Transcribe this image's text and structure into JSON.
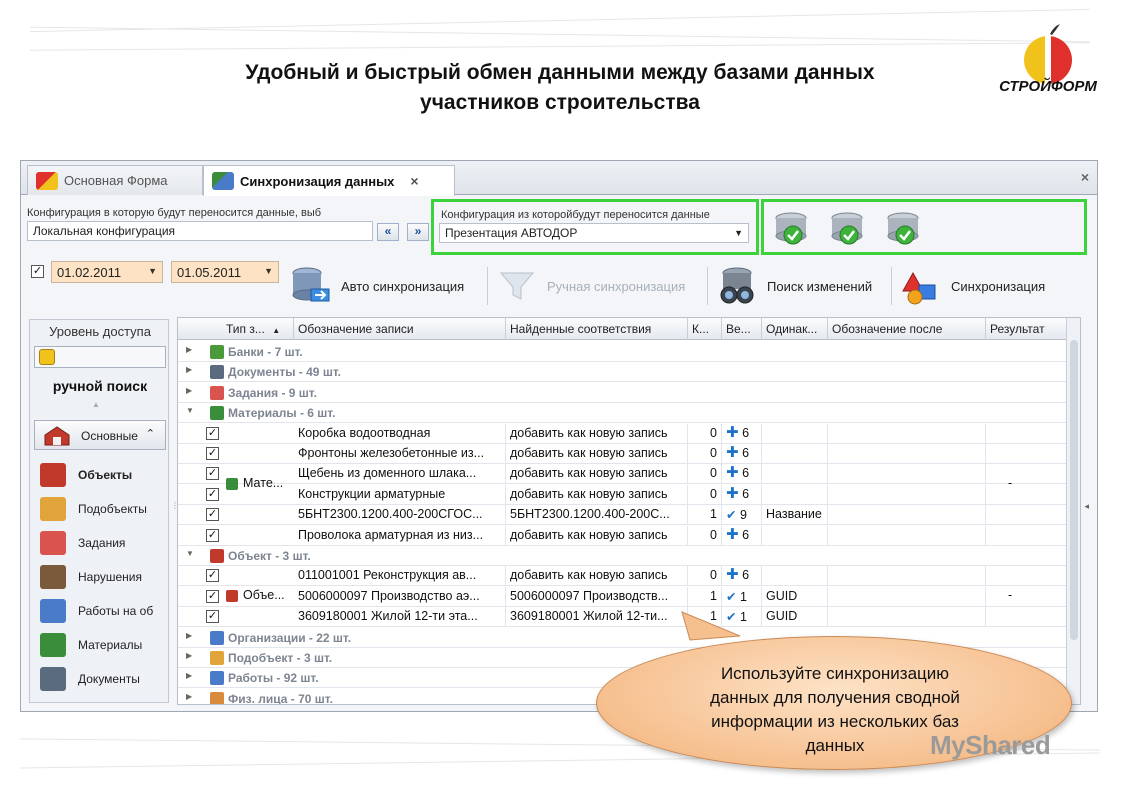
{
  "slide": {
    "title_line1": "Удобный и быстрый обмен данными между базами данных",
    "title_line2": "участников строительства",
    "logo_text": "СТРОЙФОРМ"
  },
  "window": {
    "tabs": [
      {
        "label": "Основная Форма",
        "active": false
      },
      {
        "label": "Синхронизация данных",
        "active": true
      }
    ],
    "close_glyph": "×",
    "target_config": {
      "label": "Конфигурация в которую будут переносится данные, выб",
      "value": "Локальная конфигурация"
    },
    "source_config": {
      "label": "Конфигурация из которойбудут переносится данные",
      "value": "Презентация АВТОДОР"
    },
    "nav_buttons": {
      "left": "«",
      "right": "»"
    },
    "date_filter": {
      "enabled": true,
      "from": "01.02.2011",
      "to": "01.05.2011"
    },
    "toolbar": [
      {
        "label": "Авто синхронизация",
        "enabled": true,
        "icon": "database-arrow-icon"
      },
      {
        "label": "Ручная синхронизация",
        "enabled": false,
        "icon": "funnel-icon"
      },
      {
        "label": "Поиск изменений",
        "enabled": true,
        "icon": "binoculars-icon"
      },
      {
        "label": "Синхронизация",
        "enabled": true,
        "icon": "shapes-icon"
      }
    ]
  },
  "left_panel": {
    "access_title": "Уровень доступа",
    "manual_search": "ручной поиск",
    "basic_section": "Основные",
    "items": [
      {
        "label": "Объекты",
        "bold": true,
        "color": "#c0392b"
      },
      {
        "label": "Подобъекты",
        "bold": false,
        "color": "#e0a43a"
      },
      {
        "label": "Задания",
        "bold": false,
        "color": "#d9534f"
      },
      {
        "label": "Нарушения",
        "bold": false,
        "color": "#7a5a3a"
      },
      {
        "label": "Работы на об",
        "bold": false,
        "color": "#4a7bc8"
      },
      {
        "label": "Материалы",
        "bold": false,
        "color": "#3a8d3a"
      },
      {
        "label": "Документы",
        "bold": false,
        "color": "#5a6b80"
      }
    ]
  },
  "grid": {
    "columns": [
      "Тип з...",
      "Обозначение записи",
      "Найденные соответствия",
      "К...",
      "Ве...",
      "Одинак...",
      "Обозначение после",
      "Результат"
    ],
    "groups_before": [
      {
        "label": "Банки - 7 шт.",
        "color": "#4a9a3a"
      },
      {
        "label": "Документы - 49 шт.",
        "color": "#5a6b80"
      },
      {
        "label": "Задания - 9 шт.",
        "color": "#d9534f"
      },
      {
        "label": "Материалы - 6 шт.",
        "color": "#3a8d3a"
      }
    ],
    "materials_type": "Мате...",
    "materials_result": "-",
    "materials_rows": [
      {
        "name": "Коробка водоотводная",
        "match": "добавить как новую запись",
        "k": "0",
        "mark": "plus",
        "ver": "6",
        "same": ""
      },
      {
        "name": "Фронтоны железобетонные из...",
        "match": "добавить как новую запись",
        "k": "0",
        "mark": "plus",
        "ver": "6",
        "same": ""
      },
      {
        "name": "Щебень из доменного шлака...",
        "match": "добавить как новую запись",
        "k": "0",
        "mark": "plus",
        "ver": "6",
        "same": ""
      },
      {
        "name": "Конструкции арматурные",
        "match": "добавить как новую запись",
        "k": "0",
        "mark": "plus",
        "ver": "6",
        "same": ""
      },
      {
        "name": "5БНТ2300.1200.400-200СГОС...",
        "match": "5БНТ2300.1200.400-200С...",
        "k": "1",
        "mark": "check",
        "ver": "9",
        "same": "Название"
      },
      {
        "name": "Проволока арматурная из низ...",
        "match": "добавить как новую запись",
        "k": "0",
        "mark": "plus",
        "ver": "6",
        "same": ""
      }
    ],
    "object_group": {
      "label": "Объект - 3 шт.",
      "color": "#c0392b"
    },
    "object_type": "Объе...",
    "object_result": "-",
    "object_rows": [
      {
        "name": "011001001 Реконструкция ав...",
        "match": "добавить как новую запись",
        "k": "0",
        "mark": "plus",
        "ver": "6",
        "same": ""
      },
      {
        "name": "5006000097 Производство аэ...",
        "match": "5006000097 Производств...",
        "k": "1",
        "mark": "check",
        "ver": "1",
        "same": "GUID"
      },
      {
        "name": "3609180001 Жилой 12-ти эта...",
        "match": "3609180001 Жилой 12-ти...",
        "k": "1",
        "mark": "check",
        "ver": "1",
        "same": "GUID"
      }
    ],
    "groups_after": [
      {
        "label": "Организации - 22 шт.",
        "color": "#4a7bc8"
      },
      {
        "label": "Подобъект - 3 шт.",
        "color": "#e0a43a"
      },
      {
        "label": "Работы - 92 шт.",
        "color": "#4a7bc8"
      },
      {
        "label": "Физ. лица - 70 шт.",
        "color": "#d98a3a"
      }
    ]
  },
  "callout": {
    "text_line1": "Используйте синхронизацию",
    "text_line2": "данных для получения сводной",
    "text_line3": "информации из нескольких баз",
    "text_line4": "данных"
  },
  "watermark": "MyShared",
  "colors": {
    "accent_green": "#3cd23c",
    "date_bg": "#fde3c3",
    "callout_fill": "#f6bf8e"
  }
}
